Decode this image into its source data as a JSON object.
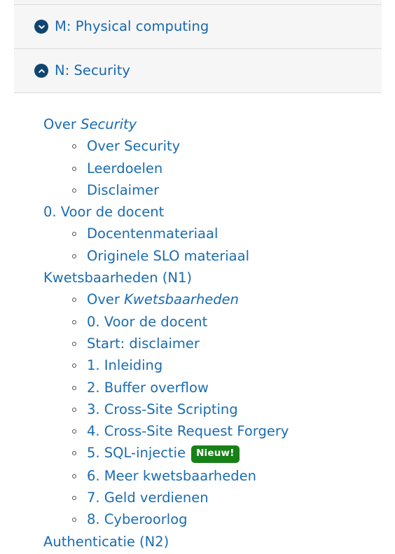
{
  "colors": {
    "panel_bg": "#f6f6f6",
    "divider": "#dcdcdc",
    "link_blue": "#1a6cb0",
    "header_blue": "#1868b0",
    "icon_navy": "#10456f",
    "badge_green": "#178117",
    "page_bg": "#ffffff"
  },
  "accordion": {
    "items": [
      {
        "id": "m-physical-computing",
        "label": "M: Physical computing",
        "icon": "chevron-down-circle-icon",
        "expanded": false
      },
      {
        "id": "n-security",
        "label": "N: Security",
        "icon": "chevron-up-circle-icon",
        "expanded": true
      }
    ]
  },
  "toc": {
    "groups": [
      {
        "title": "Over Security",
        "title_plain": "Over ",
        "title_italic": "Security",
        "children": [
          {
            "label": "Over Security"
          },
          {
            "label": "Leerdoelen"
          },
          {
            "label": "Disclaimer"
          }
        ]
      },
      {
        "title": "0. Voor de docent",
        "title_plain": "0. Voor de docent",
        "title_italic": "",
        "children": [
          {
            "label": "Docentenmateriaal"
          },
          {
            "label": "Originele SLO materiaal"
          }
        ]
      },
      {
        "title": "Kwetsbaarheden (N1)",
        "title_plain": "Kwetsbaarheden (N1)",
        "title_italic": "",
        "children": [
          {
            "label_plain": "Over ",
            "label_italic": "Kwetsbaarheden",
            "label": "Over Kwetsbaarheden"
          },
          {
            "label": "0. Voor de docent"
          },
          {
            "label": "Start: disclaimer"
          },
          {
            "label": "1. Inleiding"
          },
          {
            "label": "2. Buffer overflow"
          },
          {
            "label": "3. Cross-Site Scripting"
          },
          {
            "label": "4. Cross-Site Request Forgery"
          },
          {
            "label": "5. SQL-injectie",
            "badge": "Nieuw!"
          },
          {
            "label": "6. Meer kwetsbaarheden"
          },
          {
            "label": "7. Geld verdienen"
          },
          {
            "label": "8. Cyberoorlog"
          }
        ]
      },
      {
        "title": "Authenticatie (N2)",
        "title_plain": "Authenticatie (N2)",
        "title_italic": "",
        "children": []
      }
    ]
  }
}
